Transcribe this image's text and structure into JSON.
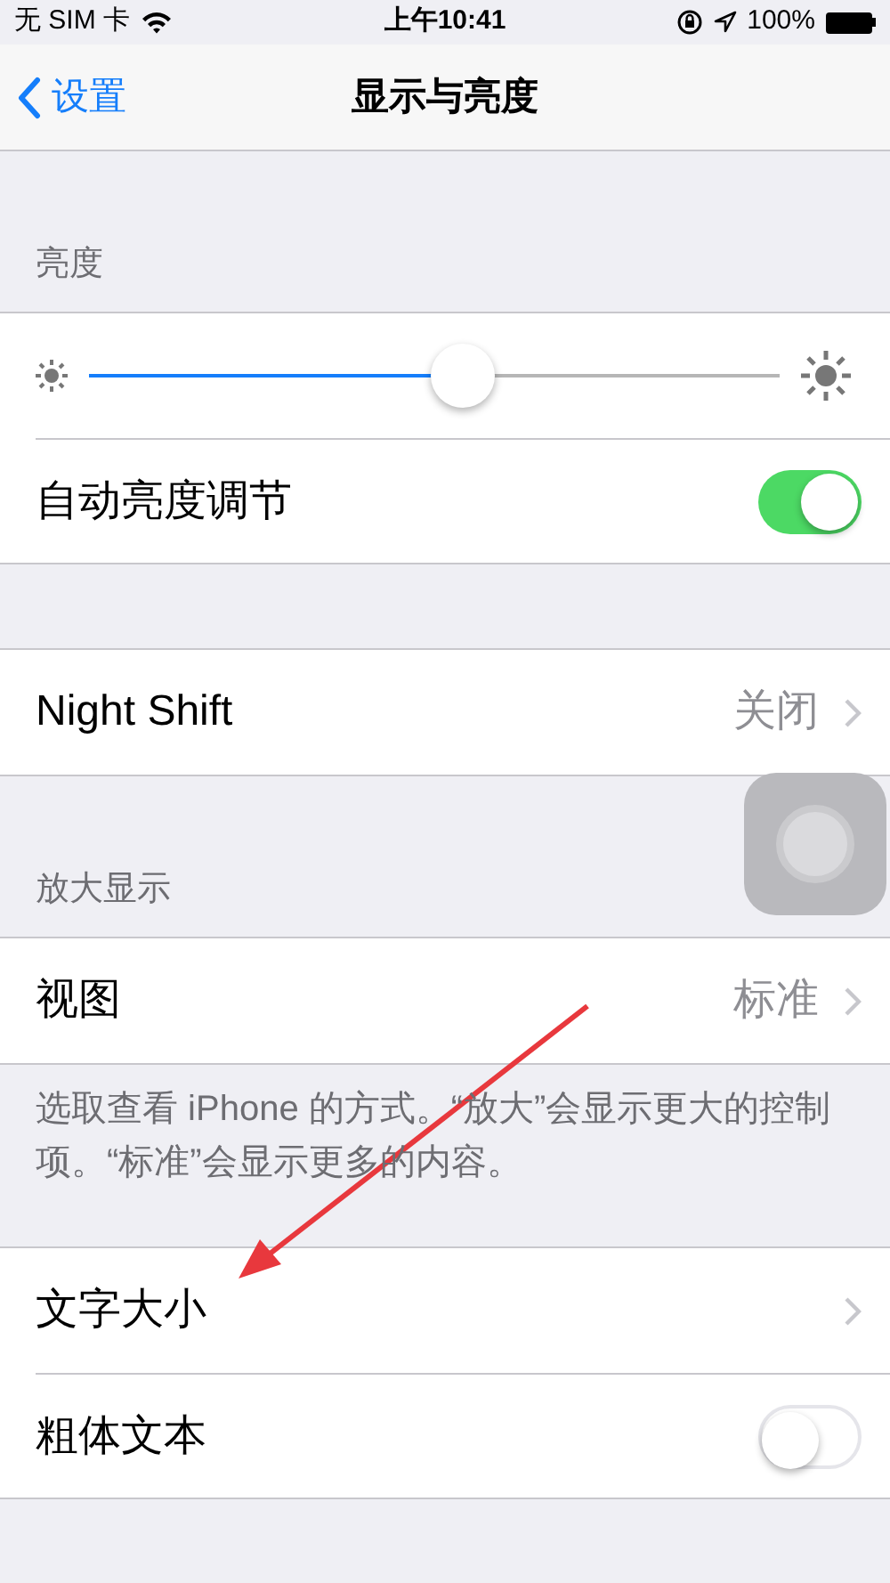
{
  "status_bar": {
    "carrier": "无 SIM 卡",
    "time": "上午10:41",
    "battery": "100%"
  },
  "nav": {
    "back": "设置",
    "title": "显示与亮度"
  },
  "sections": [
    {
      "header": "亮度",
      "rows": [
        {
          "kind": "slider",
          "level": 0.54
        },
        {
          "kind": "toggle",
          "label": "自动亮度调节",
          "on": true
        }
      ]
    },
    {
      "rows": [
        {
          "kind": "detail",
          "label": "Night Shift",
          "value": "关闭"
        }
      ]
    },
    {
      "header": "放大显示",
      "rows": [
        {
          "kind": "detail",
          "label": "视图",
          "value": "标准"
        }
      ],
      "footer": "选取查看 iPhone 的方式。“放大”会显示更大的控制项。“标准”会显示更多的内容。"
    },
    {
      "rows": [
        {
          "kind": "detail",
          "label": "文字大小"
        },
        {
          "kind": "toggle",
          "label": "粗体文本",
          "on": false
        }
      ]
    }
  ]
}
